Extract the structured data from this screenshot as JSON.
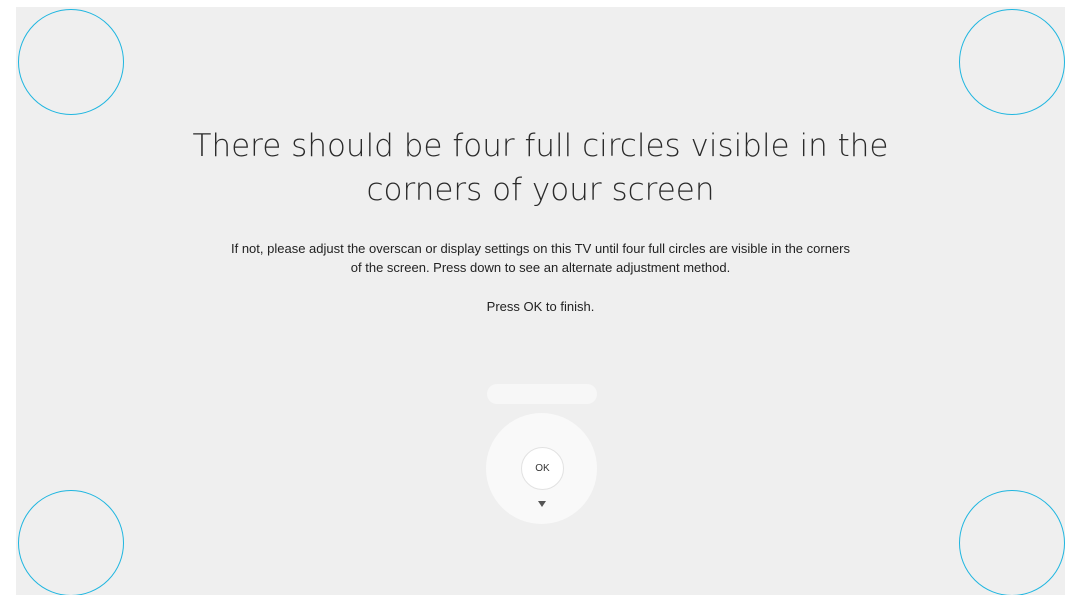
{
  "calibration": {
    "title_line1": "There should be four full circles visible in the",
    "title_line2": "corners of your screen",
    "instructions_line1": "If not, please adjust the overscan or display settings on this TV until four full circles are visible in the corners",
    "instructions_line2": "of the screen. Press down to see an alternate adjustment method.",
    "finish_text": "Press OK to finish."
  },
  "remote": {
    "ok_label": "OK",
    "down_icon": "triangle-down-icon"
  },
  "colors": {
    "circle_outline": "#1fb6e0",
    "background": "#efefef"
  }
}
